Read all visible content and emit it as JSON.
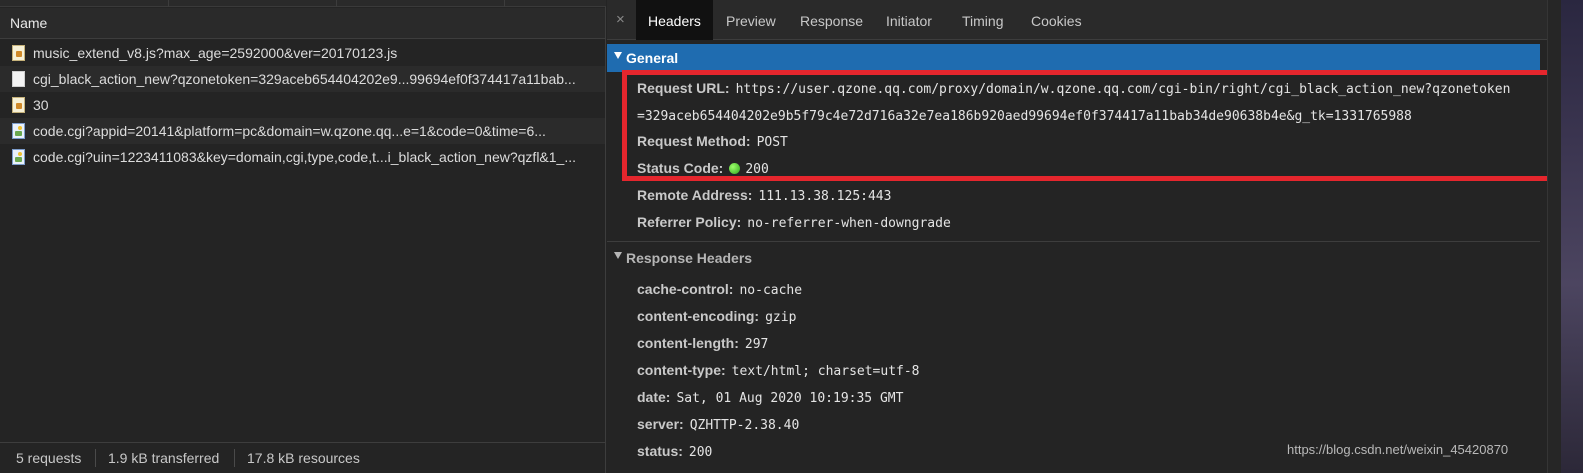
{
  "request_list": {
    "column_header": "Name",
    "rows": [
      {
        "icon": "js-file-icon",
        "name": "music_extend_v8.js?max_age=2592000&ver=20170123.js"
      },
      {
        "icon": "document-icon",
        "name": "cgi_black_action_new?qzonetoken=329aceb654404202e9...99694ef0f374417a11bab..."
      },
      {
        "icon": "js-file-icon",
        "name": "30"
      },
      {
        "icon": "image-icon",
        "name": "code.cgi?appid=20141&platform=pc&domain=w.qzone.qq...e=1&code=0&time=6..."
      },
      {
        "icon": "image-icon",
        "name": "code.cgi?uin=1223411083&key=domain,cgi,type,code,t...i_black_action_new?qzfl&1_..."
      }
    ]
  },
  "status_bar": {
    "requests": "5 requests",
    "transferred": "1.9 kB transferred",
    "resources": "17.8 kB resources"
  },
  "tabs": {
    "close_glyph": "×",
    "items": [
      "Headers",
      "Preview",
      "Response",
      "Initiator",
      "Timing",
      "Cookies"
    ],
    "active": "Headers"
  },
  "general": {
    "title": "General",
    "request_url_label": "Request URL:",
    "request_url_line1": "https://user.qzone.qq.com/proxy/domain/w.qzone.qq.com/cgi-bin/right/cgi_black_action_new?qzonetoken",
    "request_url_line2": "=329aceb654404202e9b5f79c4e72d716a32e7ea186b920aed99694ef0f374417a11bab34de90638b4e&g_tk=1331765988",
    "request_method_label": "Request Method:",
    "request_method": "POST",
    "status_code_label": "Status Code:",
    "status_code": "200",
    "remote_address_label": "Remote Address:",
    "remote_address": "111.13.38.125:443",
    "referrer_policy_label": "Referrer Policy:",
    "referrer_policy": "no-referrer-when-downgrade"
  },
  "response_headers": {
    "title": "Response Headers",
    "items": [
      {
        "key": "cache-control:",
        "value": "no-cache"
      },
      {
        "key": "content-encoding:",
        "value": "gzip"
      },
      {
        "key": "content-length:",
        "value": "297"
      },
      {
        "key": "content-type:",
        "value": "text/html; charset=utf-8"
      },
      {
        "key": "date:",
        "value": "Sat, 01 Aug 2020 10:19:35 GMT"
      },
      {
        "key": "server:",
        "value": "QZHTTP-2.38.40"
      },
      {
        "key": "status:",
        "value": "200"
      }
    ]
  },
  "watermark": "https://blog.csdn.net/weixin_45420870",
  "colors": {
    "selected_section": "#1f6cb0",
    "highlight_box": "#e5262d",
    "status_ok": "#2fa61c"
  }
}
